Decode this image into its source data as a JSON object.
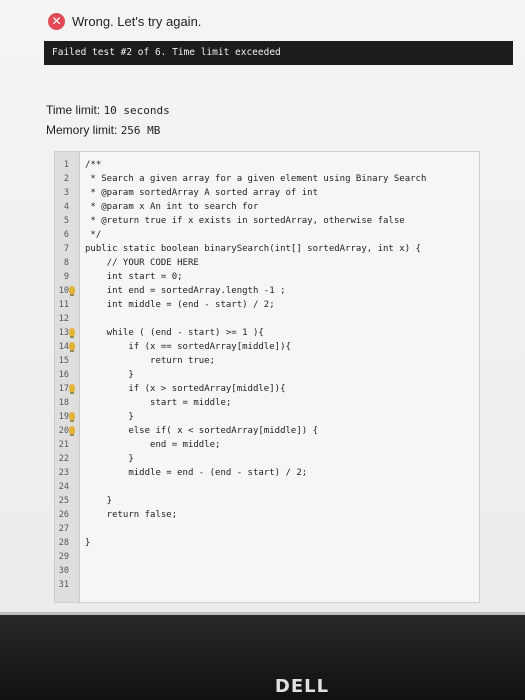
{
  "status": {
    "message": "Wrong. Let's try again."
  },
  "failure": {
    "text": "Failed test #2 of 6. Time limit exceeded"
  },
  "limits": {
    "time_label": "Time limit:",
    "time_value": "10 seconds",
    "memory_label": "Memory limit:",
    "memory_value": "256 MB"
  },
  "editor": {
    "lines": [
      {
        "n": "1",
        "code": "/**",
        "bulb": false
      },
      {
        "n": "2",
        "code": " * Search a given array for a given element using Binary Search",
        "bulb": false
      },
      {
        "n": "3",
        "code": " * @param sortedArray A sorted array of int",
        "bulb": false
      },
      {
        "n": "4",
        "code": " * @param x An int to search for",
        "bulb": false
      },
      {
        "n": "5",
        "code": " * @return true if x exists in sortedArray, otherwise false",
        "bulb": false
      },
      {
        "n": "6",
        "code": " */",
        "bulb": false
      },
      {
        "n": "7",
        "code": "public static boolean binarySearch(int[] sortedArray, int x) {",
        "bulb": false
      },
      {
        "n": "8",
        "code": "    // YOUR CODE HERE",
        "bulb": false
      },
      {
        "n": "9",
        "code": "    int start = 0;",
        "bulb": false
      },
      {
        "n": "10",
        "code": "    int end = sortedArray.length -1 ;",
        "bulb": true
      },
      {
        "n": "11",
        "code": "    int middle = (end - start) / 2;",
        "bulb": false
      },
      {
        "n": "12",
        "code": "",
        "bulb": false
      },
      {
        "n": "13",
        "code": "    while ( (end - start) >= 1 ){",
        "bulb": true
      },
      {
        "n": "14",
        "code": "        if (x == sortedArray[middle]){",
        "bulb": true
      },
      {
        "n": "15",
        "code": "            return true;",
        "bulb": false
      },
      {
        "n": "16",
        "code": "        }",
        "bulb": false
      },
      {
        "n": "17",
        "code": "        if (x > sortedArray[middle]){",
        "bulb": true
      },
      {
        "n": "18",
        "code": "            start = middle;",
        "bulb": false
      },
      {
        "n": "19",
        "code": "        }",
        "bulb": true
      },
      {
        "n": "20",
        "code": "        else if( x < sortedArray[middle]) {",
        "bulb": true
      },
      {
        "n": "21",
        "code": "            end = middle;",
        "bulb": false
      },
      {
        "n": "22",
        "code": "        }",
        "bulb": false
      },
      {
        "n": "23",
        "code": "        middle = end - (end - start) / 2;",
        "bulb": false
      },
      {
        "n": "24",
        "code": "",
        "bulb": false
      },
      {
        "n": "25",
        "code": "    }",
        "bulb": false
      },
      {
        "n": "26",
        "code": "    return false;",
        "bulb": false
      },
      {
        "n": "27",
        "code": "",
        "bulb": false
      },
      {
        "n": "28",
        "code": "}",
        "bulb": false
      },
      {
        "n": "29",
        "code": "",
        "bulb": false
      },
      {
        "n": "30",
        "code": "",
        "bulb": false
      },
      {
        "n": "31",
        "code": "",
        "bulb": false
      }
    ]
  },
  "hardware": {
    "logo": "DELL"
  },
  "colors": {
    "error": "#e04a57",
    "bulb": "#e2b53a",
    "bar": "#1c1c1c"
  }
}
